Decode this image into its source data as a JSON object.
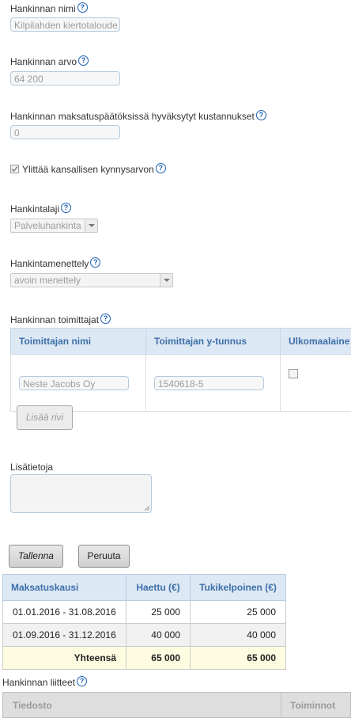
{
  "fields": {
    "name_label": "Hankinnan nimi",
    "name_value": "Kilpilahden kiertotaloude",
    "value_label": "Hankinnan arvo",
    "value_value": "64 200",
    "approved_label": "Hankinnan maksatuspäätöksissä hyväksytyt kustannukset",
    "approved_value": "0",
    "threshold_label": "Ylittää kansallisen kynnysarvon",
    "threshold_checked": true,
    "type_label": "Hankintalaji",
    "type_value": "Palveluhankinta",
    "procedure_label": "Hankintamenettely",
    "procedure_value": "avoin menettely",
    "help_glyph": "?"
  },
  "suppliers": {
    "label": "Hankinnan toimittajat",
    "columns": [
      "Toimittajan nimi",
      "Toimittajan y-tunnus",
      "Ulkomaalaine"
    ],
    "rows": [
      {
        "name": "Neste Jacobs Oy",
        "business_id": "1540618-5",
        "foreign": false
      }
    ],
    "add_row_label": "Lisää rivi"
  },
  "extra_info": {
    "label": "Lisätietoja",
    "value": ""
  },
  "actions": {
    "save_label": "Tallenna",
    "cancel_label": "Peruuta"
  },
  "payments": {
    "columns": [
      "Maksatuskausi",
      "Haettu (€)",
      "Tukikelpoinen (€)"
    ],
    "rows": [
      {
        "period": "01.01.2016 - 31.08.2016",
        "applied": "25 000",
        "eligible": "25 000"
      },
      {
        "period": "01.09.2016 - 31.12.2016",
        "applied": "40 000",
        "eligible": "40 000"
      }
    ],
    "total": {
      "label": "Yhteensä",
      "applied": "65 000",
      "eligible": "65 000"
    }
  },
  "attachments": {
    "label": "Hankinnan liitteet",
    "columns": [
      "Tiedosto",
      "Toiminnot"
    ]
  },
  "colors": {
    "header_blue": "#3d6fa8",
    "header_bg": "#dde8f5",
    "total_bg": "#fdfce0",
    "help_icon": "#1a5fb4"
  }
}
